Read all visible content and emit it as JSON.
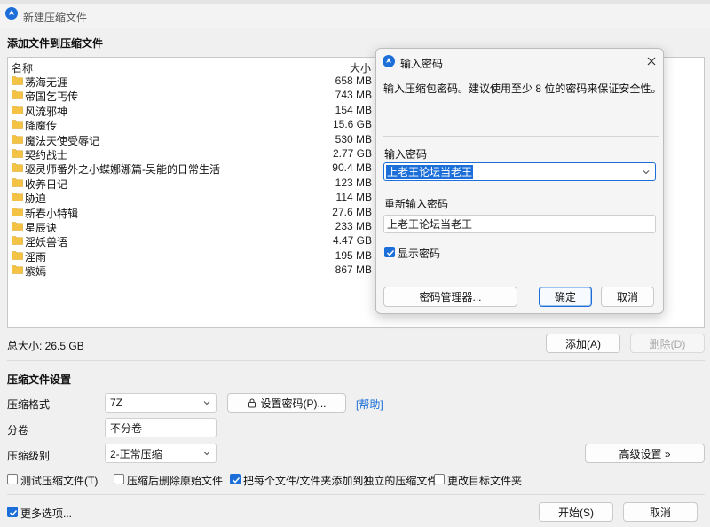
{
  "window": {
    "title": "新建压缩文件",
    "add_files_title": "添加文件到压缩文件"
  },
  "file_list": {
    "col_name": "名称",
    "col_size": "大小",
    "rows": [
      {
        "name": "荡海无涯",
        "size": "658 MB"
      },
      {
        "name": "帝国乞丐传",
        "size": "743 MB"
      },
      {
        "name": "风流邪神",
        "size": "154 MB"
      },
      {
        "name": "降魔传",
        "size": "15.6 GB"
      },
      {
        "name": "魔法天使受辱记",
        "size": "530 MB"
      },
      {
        "name": "契约战士",
        "size": "2.77 GB"
      },
      {
        "name": "驱灵师番外之小蝶娜娜篇-吴能的日常生活",
        "size": "90.4 MB"
      },
      {
        "name": "收养日记",
        "size": "123 MB"
      },
      {
        "name": "胁迫",
        "size": "114 MB"
      },
      {
        "name": "新春小特辑",
        "size": "27.6 MB"
      },
      {
        "name": "星辰诀",
        "size": "233 MB"
      },
      {
        "name": "淫妖兽语",
        "size": "4.47 GB"
      },
      {
        "name": "淫雨",
        "size": "195 MB"
      },
      {
        "name": "紫嫣",
        "size": "867 MB"
      }
    ]
  },
  "total_size": "总大小: 26.5 GB",
  "buttons": {
    "add": "添加(A)",
    "delete": "删除(D)",
    "set_password": "设置密码(P)...",
    "help": "[帮助]",
    "advanced": "高级设置 »",
    "start": "开始(S)",
    "cancel": "取消"
  },
  "settings": {
    "title": "压缩文件设置",
    "format_label": "压缩格式",
    "format_value": "7Z",
    "volume_label": "分卷",
    "volume_value": "不分卷",
    "level_label": "压缩级别",
    "level_value": "2-正常压缩"
  },
  "checkboxes": {
    "test": {
      "label": "测试压缩文件(T)",
      "checked": false
    },
    "delete_after": {
      "label": "压缩后删除原始文件",
      "checked": false
    },
    "separate": {
      "label": "把每个文件/文件夹添加到独立的压缩文件",
      "checked": true
    },
    "change_target": {
      "label": "更改目标文件夹",
      "checked": false
    },
    "more_options": {
      "label": "更多选项...",
      "checked": true
    }
  },
  "dialog": {
    "title": "输入密码",
    "info": "输入压缩包密码。建议使用至少 8 位的密码来保证安全性。",
    "password_label": "输入密码",
    "password_value": "上老王论坛当老王",
    "reenter_label": "重新输入密码",
    "reenter_value": "上老王论坛当老王",
    "show_password": {
      "label": "显示密码",
      "checked": true
    },
    "manager_button": "密码管理器...",
    "ok_button": "确定",
    "cancel_button": "取消"
  },
  "colors": {
    "accent": "#1c6fd8",
    "folder": "#f5c344"
  }
}
